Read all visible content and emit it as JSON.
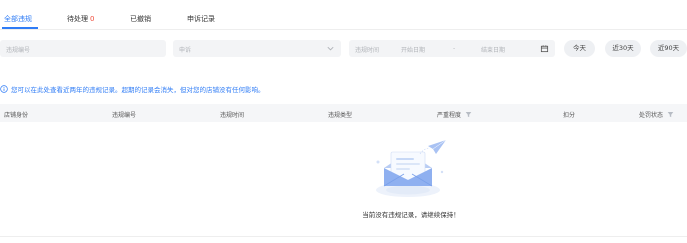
{
  "tabs": [
    {
      "label": "全部违规"
    },
    {
      "label": "待处理",
      "count": "0"
    },
    {
      "label": "已撤销"
    },
    {
      "label": "申诉记录"
    }
  ],
  "filters": {
    "violation_no_placeholder": "违规编号",
    "type_placeholder": "申诉",
    "time_label": "违规时间",
    "start_date_placeholder": "开始日期",
    "date_separator": "-",
    "end_date_placeholder": "结束日期",
    "quick_ranges": [
      "今天",
      "近30天",
      "近90天"
    ]
  },
  "notice": {
    "text": "您可以在此处查看近两年的违规记录。超期的记录会消失，但对您的店铺没有任何影响。"
  },
  "table": {
    "columns": [
      "店铺身份",
      "违规编号",
      "违规时间",
      "违规类型",
      "严重程度",
      "扣分",
      "处罚状态"
    ]
  },
  "empty": {
    "message": "当前没有违规记录，请继续保持！"
  },
  "colors": {
    "accent": "#2f7cf6",
    "count_red": "#f04b3a",
    "input_bg": "#f3f4f6",
    "header_bg": "#f5f6f8"
  }
}
